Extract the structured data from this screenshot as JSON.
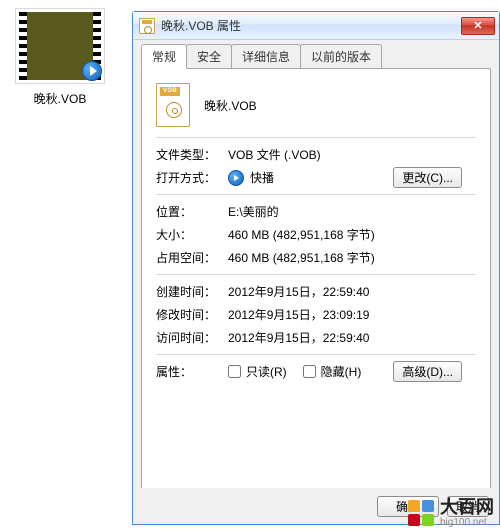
{
  "desktop": {
    "label": "晚秋.VOB"
  },
  "window": {
    "title": "晚秋.VOB 属性"
  },
  "tabs": {
    "general": "常规",
    "security": "安全",
    "details": "详细信息",
    "previous": "以前的版本"
  },
  "general": {
    "icon_tag": "VOB",
    "filename": "晚秋.VOB",
    "labels": {
      "filetype": "文件类型：",
      "openwith": "打开方式：",
      "location": "位置：",
      "size": "大小：",
      "sizeondisk": "占用空间：",
      "created": "创建时间：",
      "modified": "修改时间：",
      "accessed": "访问时间：",
      "attributes": "属性："
    },
    "values": {
      "filetype": "VOB 文件 (.VOB)",
      "openwith": "快播",
      "location": "E:\\美丽的",
      "size": "460 MB (482,951,168 字节)",
      "sizeondisk": "460 MB (482,951,168 字节)",
      "created": "2012年9月15日，22:59:40",
      "modified": "2012年9月15日，23:09:19",
      "accessed": "2012年9月15日，22:59:40"
    },
    "buttons": {
      "change": "更改(C)...",
      "advanced": "高级(D)..."
    },
    "attrs": {
      "readonly": "只读(R)",
      "hidden": "隐藏(H)"
    }
  },
  "dialog_buttons": {
    "ok": "确定",
    "cancel": "取消"
  },
  "watermark": {
    "name": "大百网",
    "url": "big100.net"
  },
  "colors": {
    "wm1": "#f5a623",
    "wm2": "#4a90e2",
    "wm3": "#d0021b",
    "wm4": "#7ed321"
  }
}
